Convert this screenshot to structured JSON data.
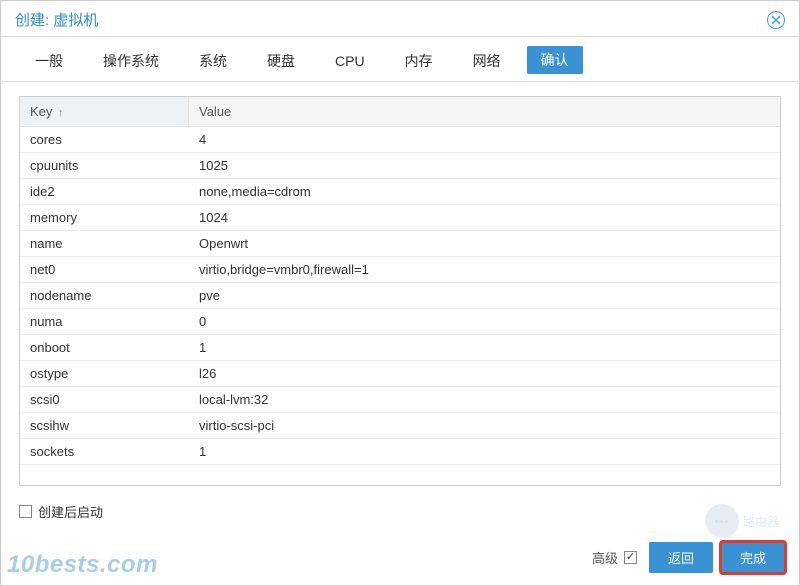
{
  "dialog": {
    "title": "创建: 虚拟机"
  },
  "tabs": [
    {
      "label": "一般"
    },
    {
      "label": "操作系统"
    },
    {
      "label": "系统"
    },
    {
      "label": "硬盘"
    },
    {
      "label": "CPU"
    },
    {
      "label": "内存"
    },
    {
      "label": "网络"
    },
    {
      "label": "确认",
      "active": true
    }
  ],
  "grid": {
    "headers": {
      "key": "Key",
      "sort_dir": "↑",
      "value": "Value"
    },
    "rows": [
      {
        "key": "cores",
        "value": "4"
      },
      {
        "key": "cpuunits",
        "value": "1025"
      },
      {
        "key": "ide2",
        "value": "none,media=cdrom"
      },
      {
        "key": "memory",
        "value": "1024"
      },
      {
        "key": "name",
        "value": "Openwrt"
      },
      {
        "key": "net0",
        "value": "virtio,bridge=vmbr0,firewall=1"
      },
      {
        "key": "nodename",
        "value": "pve"
      },
      {
        "key": "numa",
        "value": "0"
      },
      {
        "key": "onboot",
        "value": "1"
      },
      {
        "key": "ostype",
        "value": "l26"
      },
      {
        "key": "scsi0",
        "value": "local-lvm:32"
      },
      {
        "key": "scsihw",
        "value": "virtio-scsi-pci"
      },
      {
        "key": "sockets",
        "value": "1"
      }
    ]
  },
  "options": {
    "start_after_create_label": "创建后启动",
    "start_after_create_checked": false,
    "advanced_label": "高级",
    "advanced_checked": true
  },
  "footer": {
    "back_label": "返回",
    "finish_label": "完成"
  },
  "watermarks": {
    "left": "10bests.com",
    "right": "路由器"
  }
}
